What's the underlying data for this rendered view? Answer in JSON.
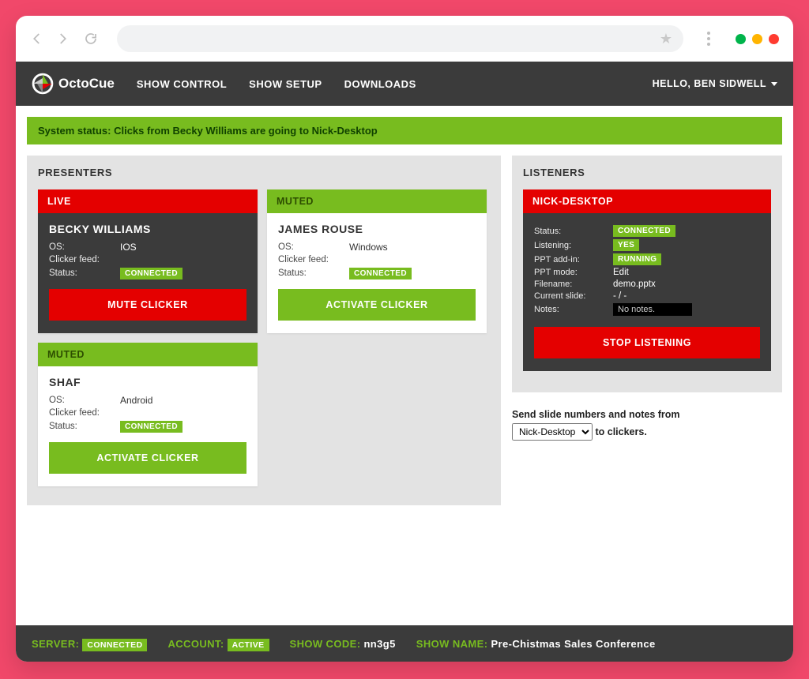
{
  "brand": {
    "name": "OctoCue"
  },
  "nav": {
    "items": [
      "SHOW CONTROL",
      "SHOW SETUP",
      "DOWNLOADS"
    ],
    "user_greeting": "HELLO, BEN SIDWELL"
  },
  "status_line": "System status: Clicks from Becky Williams are going to Nick-Desktop",
  "panels": {
    "presenters_title": "PRESENTERS",
    "listeners_title": "LISTENERS"
  },
  "presenters": [
    {
      "state": "LIVE",
      "state_kind": "live",
      "theme": "dark",
      "name": "BECKY WILLIAMS",
      "os": "IOS",
      "clicker_feed": "",
      "status_badge": "CONNECTED",
      "button_label": "MUTE CLICKER",
      "button_kind": "red"
    },
    {
      "state": "MUTED",
      "state_kind": "muted",
      "theme": "light",
      "name": "JAMES ROUSE",
      "os": "Windows",
      "clicker_feed": "",
      "status_badge": "CONNECTED",
      "button_label": "ACTIVATE CLICKER",
      "button_kind": "green"
    },
    {
      "state": "MUTED",
      "state_kind": "muted",
      "theme": "light",
      "name": "SHAF",
      "os": "Android",
      "clicker_feed": "",
      "status_badge": "CONNECTED",
      "button_label": "ACTIVATE CLICKER",
      "button_kind": "green"
    }
  ],
  "field_labels": {
    "os": "OS:",
    "clicker_feed": "Clicker feed:",
    "status": "Status:"
  },
  "listener": {
    "name": "NICK-DESKTOP",
    "rows": {
      "status_label": "Status:",
      "status_value": "CONNECTED",
      "listening_label": "Listening:",
      "listening_value": "YES",
      "addin_label": "PPT add-in:",
      "addin_value": "RUNNING",
      "mode_label": "PPT mode:",
      "mode_value": "Edit",
      "filename_label": "Filename:",
      "filename_value": "demo.pptx",
      "slide_label": "Current slide:",
      "slide_value": "- / -",
      "notes_label": "Notes:",
      "notes_value": "No notes."
    },
    "button_label": "STOP LISTENING"
  },
  "send_notes": {
    "prefix": "Send slide numbers and notes from",
    "selected": "Nick-Desktop",
    "options": [
      "Nick-Desktop"
    ],
    "suffix": "to clickers."
  },
  "footer": {
    "server_label": "SERVER:",
    "server_value": "CONNECTED",
    "account_label": "ACCOUNT:",
    "account_value": "ACTIVE",
    "showcode_label": "SHOW CODE:",
    "showcode_value": "nn3g5",
    "showname_label": "SHOW NAME:",
    "showname_value": "Pre-Chistmas Sales Conference"
  }
}
